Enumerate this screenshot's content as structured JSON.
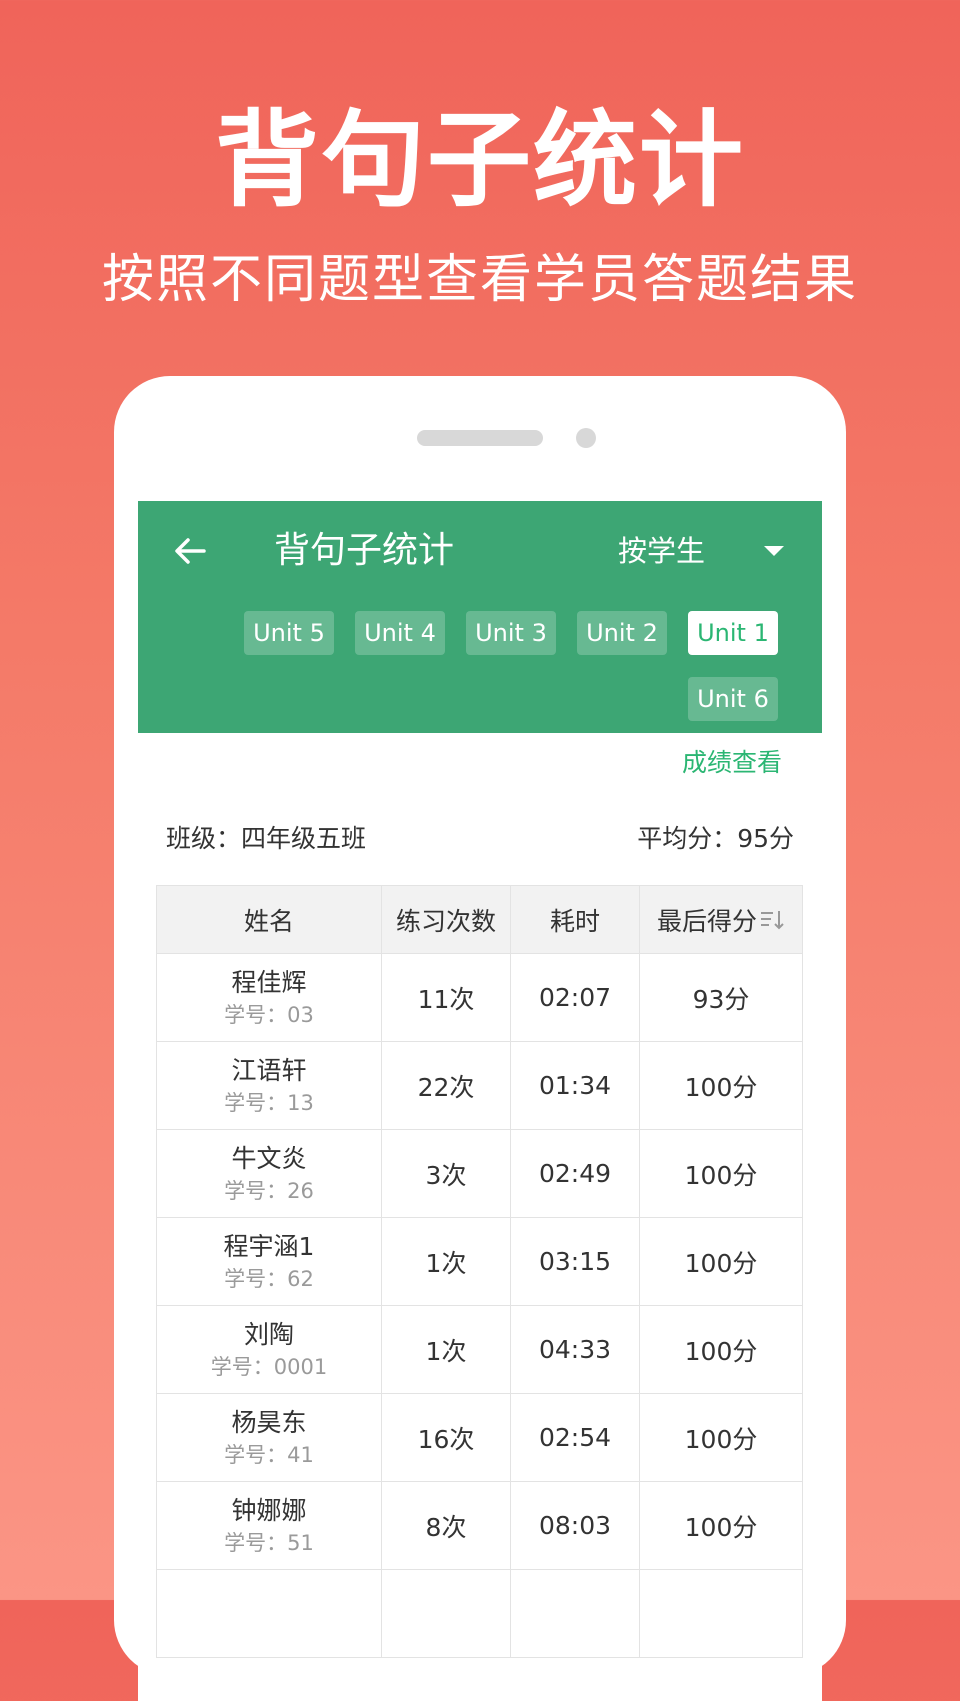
{
  "promo": {
    "title": "背句子统计",
    "subtitle": "按照不同题型查看学员答题结果"
  },
  "appbar": {
    "back_icon": "arrow-left-icon",
    "title": "背句子统计",
    "mode_label": "按学生",
    "dropdown_icon": "triangle-down-icon",
    "accent_color": "#3da674"
  },
  "unit_tabs": [
    {
      "label": "Unit 5",
      "active": false
    },
    {
      "label": "Unit 4",
      "active": false
    },
    {
      "label": "Unit 3",
      "active": false
    },
    {
      "label": "Unit 2",
      "active": false
    },
    {
      "label": "Unit 1",
      "active": true
    },
    {
      "label": "Unit 6",
      "active": false
    }
  ],
  "score_link": "成绩查看",
  "class_info": "班级：四年级五班",
  "average": "平均分：95分",
  "table": {
    "headers": [
      "姓名",
      "练习次数",
      "耗时",
      "最后得分"
    ],
    "sort_icon": "sort-icon",
    "rows": [
      {
        "name": "程佳辉",
        "id": "学号：03",
        "count": "11次",
        "time": "02:07",
        "score": "93分"
      },
      {
        "name": "江语轩",
        "id": "学号：13",
        "count": "22次",
        "time": "01:34",
        "score": "100分"
      },
      {
        "name": "牛文炎",
        "id": "学号：26",
        "count": "3次",
        "time": "02:49",
        "score": "100分"
      },
      {
        "name": "程宇涵1",
        "id": "学号：62",
        "count": "1次",
        "time": "03:15",
        "score": "100分"
      },
      {
        "name": "刘陶",
        "id": "学号：0001",
        "count": "1次",
        "time": "04:33",
        "score": "100分"
      },
      {
        "name": "杨昊东",
        "id": "学号：41",
        "count": "16次",
        "time": "02:54",
        "score": "100分"
      },
      {
        "name": "钟娜娜",
        "id": "学号：51",
        "count": "8次",
        "time": "08:03",
        "score": "100分"
      }
    ]
  }
}
